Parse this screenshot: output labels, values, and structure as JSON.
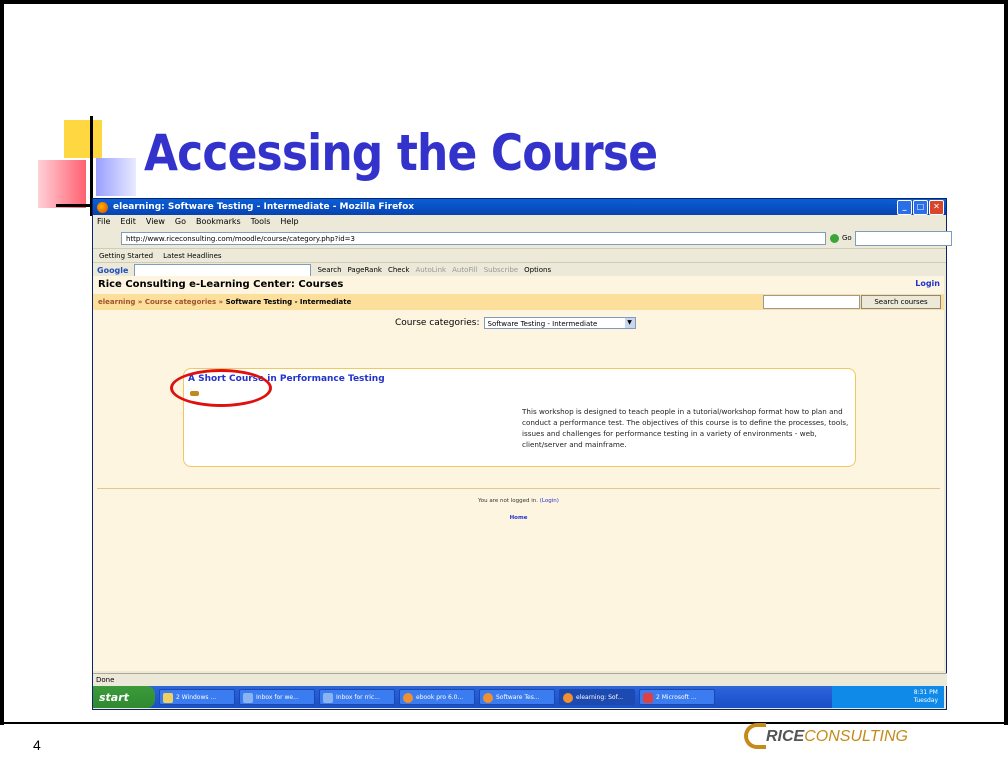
{
  "slide": {
    "title": "Accessing the Course",
    "number": "4"
  },
  "logo": {
    "part1": "RICE",
    "part2": "CONSULTING"
  },
  "browser": {
    "window_title": "elearning: Software Testing - Intermediate - Mozilla Firefox",
    "menu": [
      "File",
      "Edit",
      "View",
      "Go",
      "Bookmarks",
      "Tools",
      "Help"
    ],
    "url": "http://www.riceconsulting.com/moodle/course/category.php?id=3",
    "go_label": "Go",
    "bookmarks": [
      "Getting Started",
      "Latest Headlines"
    ],
    "google_toolbar": {
      "logo": "Google",
      "items": [
        "Search",
        "PageRank",
        "Check",
        "AutoLink",
        "AutoFill",
        "Subscribe",
        "Options"
      ]
    },
    "status": "Done"
  },
  "page": {
    "site_title": "Rice Consulting e-Learning Center: Courses",
    "login": "Login",
    "breadcrumb": [
      "elearning",
      "Course categories",
      "Software Testing - Intermediate"
    ],
    "breadcrumb_sep": "»",
    "search_button": "Search courses",
    "category_label": "Course categories:",
    "category_selected": "Software Testing - Intermediate",
    "course_title": "A Short Course in Performance Testing",
    "course_description": "This workshop is designed to teach people in a tutorial/workshop format how to plan and conduct a performance test. The objectives of this course is to define the processes, tools, issues and challenges for performance testing in a variety of environments - web, client/server and mainframe.",
    "footer_text": "You are not logged in.",
    "footer_login": "(Login)",
    "footer_home": "Home"
  },
  "taskbar": {
    "start": "start",
    "tasks": [
      "2 Windows ...",
      "Inbox for we...",
      "Inbox for rric...",
      "ebook pro 6.0...",
      "Software Tes...",
      "elearning: Sof...",
      "2 Microsoft ..."
    ],
    "time": "8:31 PM",
    "day": "Tuesday"
  },
  "colors": {
    "title": "#3333cc",
    "page_bg": "#fdf5e0",
    "crumb_bg": "#fbdf9a",
    "link": "#2233cc",
    "highlight_circle": "#e01010",
    "logo_accent": "#c58a1a"
  }
}
